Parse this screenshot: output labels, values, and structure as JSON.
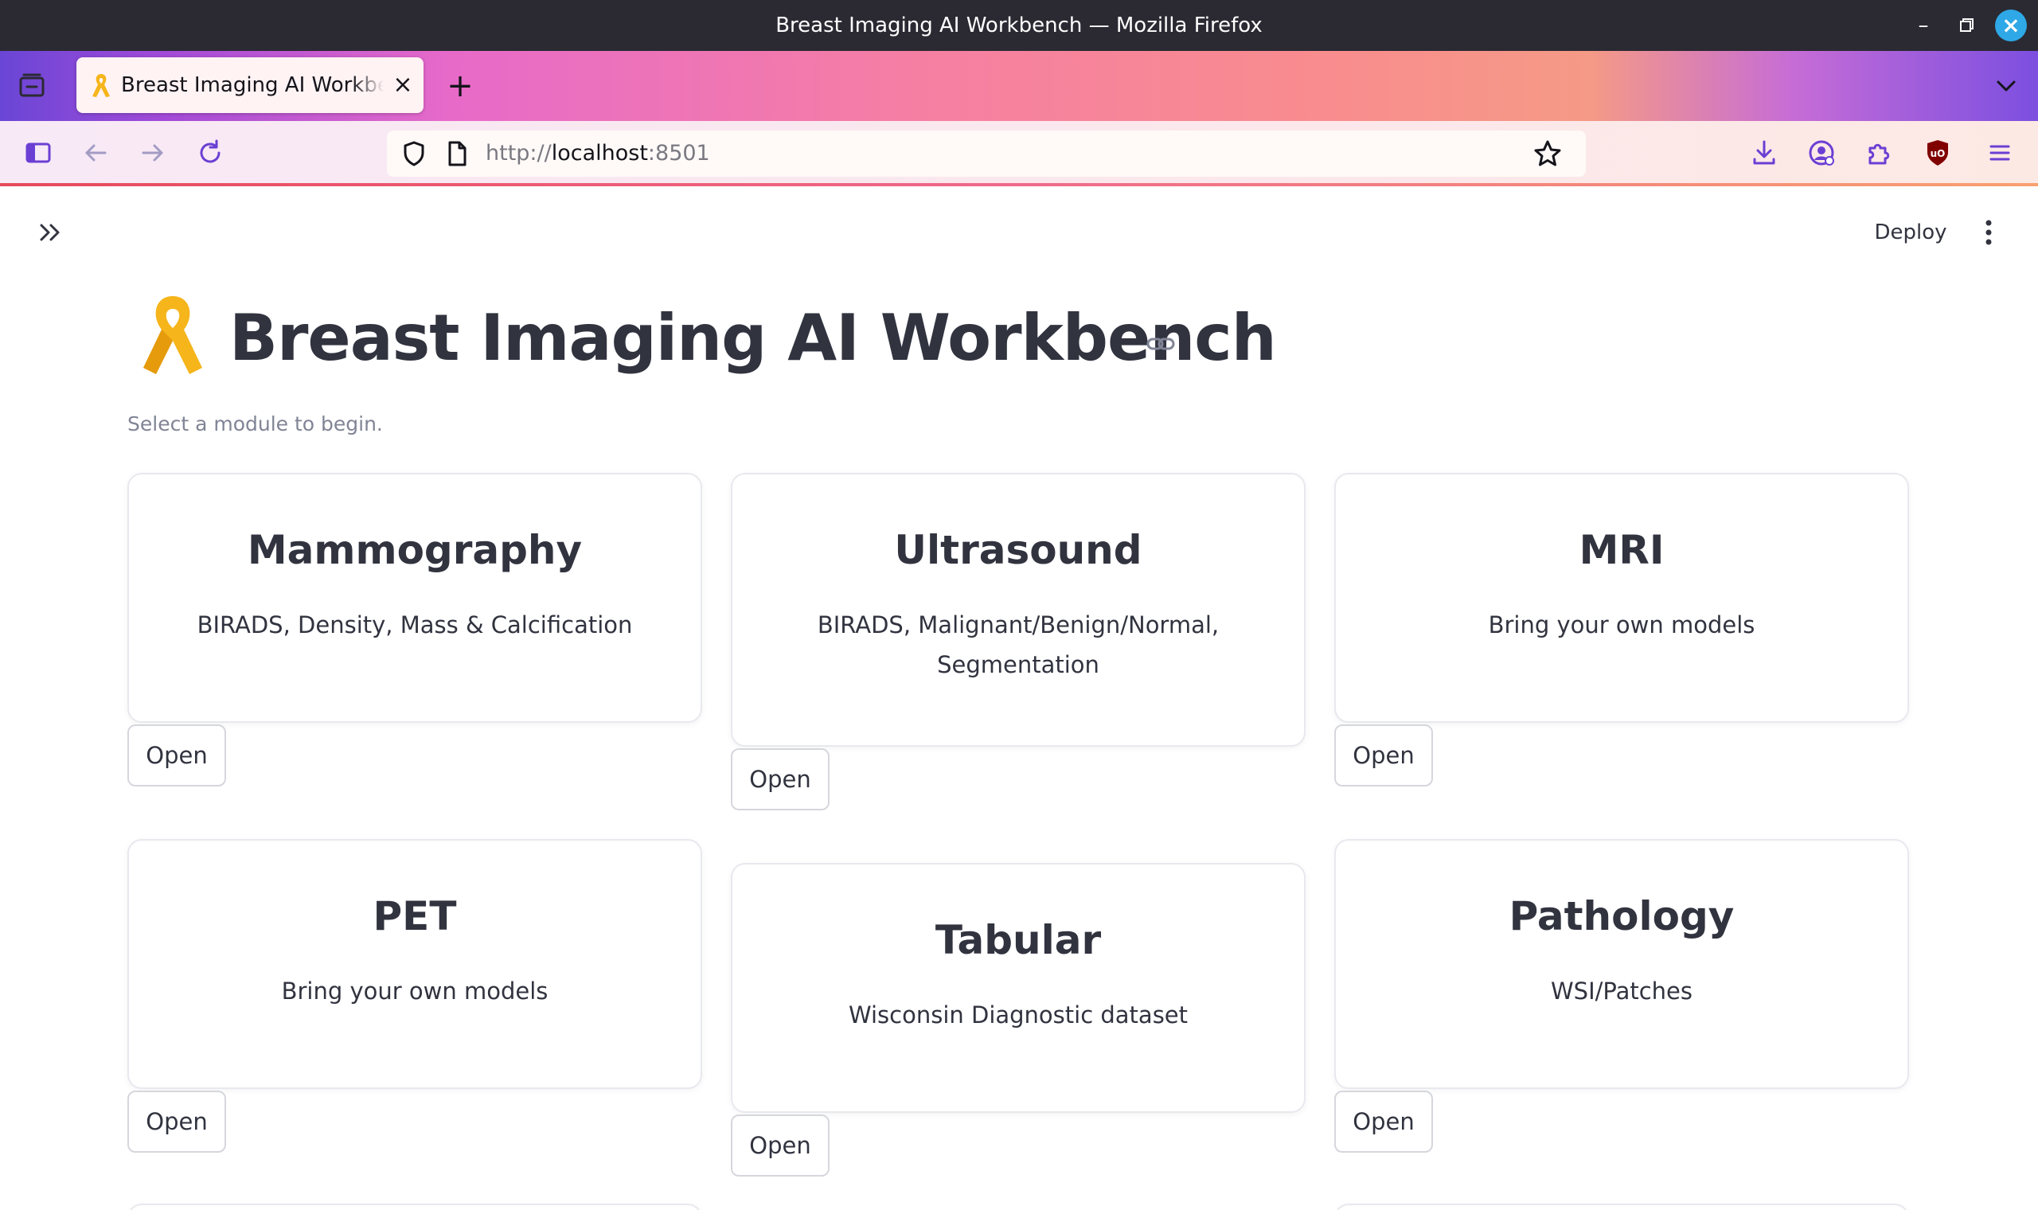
{
  "window": {
    "title": "Breast Imaging AI Workbench — Mozilla Firefox"
  },
  "browser": {
    "tab": {
      "label": "Breast Imaging AI Workbench",
      "favicon": "ribbon-icon"
    },
    "url": {
      "scheme": "http://",
      "host": "localhost",
      "port": ":8501"
    },
    "icons": [
      "tab-manager-icon",
      "new-tab-icon",
      "tab-list-icon",
      "sidebar-icon",
      "back-icon",
      "forward-icon",
      "reload-icon",
      "shield-icon",
      "page-icon",
      "bookmark-star-icon",
      "downloads-icon",
      "account-icon",
      "extensions-icon",
      "ublock-icon",
      "menu-icon"
    ]
  },
  "app": {
    "deploy_label": "Deploy",
    "title": "Breast Imaging AI Workbench",
    "subtitle": "Select a module to begin.",
    "open_label": "Open"
  },
  "modules": [
    {
      "title": "Mammography",
      "desc": "BIRADS, Density, Mass & Calcification"
    },
    {
      "title": "Ultrasound",
      "desc": "BIRADS, Malignant/Benign/Normal, Segmentation"
    },
    {
      "title": "MRI",
      "desc": "Bring your own models"
    },
    {
      "title": "PET",
      "desc": "Bring your own models"
    },
    {
      "title": "Tabular",
      "desc": "Wisconsin Diagnostic dataset"
    },
    {
      "title": "Pathology",
      "desc": "WSI/Patches"
    }
  ],
  "colors": {
    "ribbon": "#f5b51b",
    "text": "#31333f",
    "muted": "#808495",
    "close_button": "#2ea8e6"
  }
}
